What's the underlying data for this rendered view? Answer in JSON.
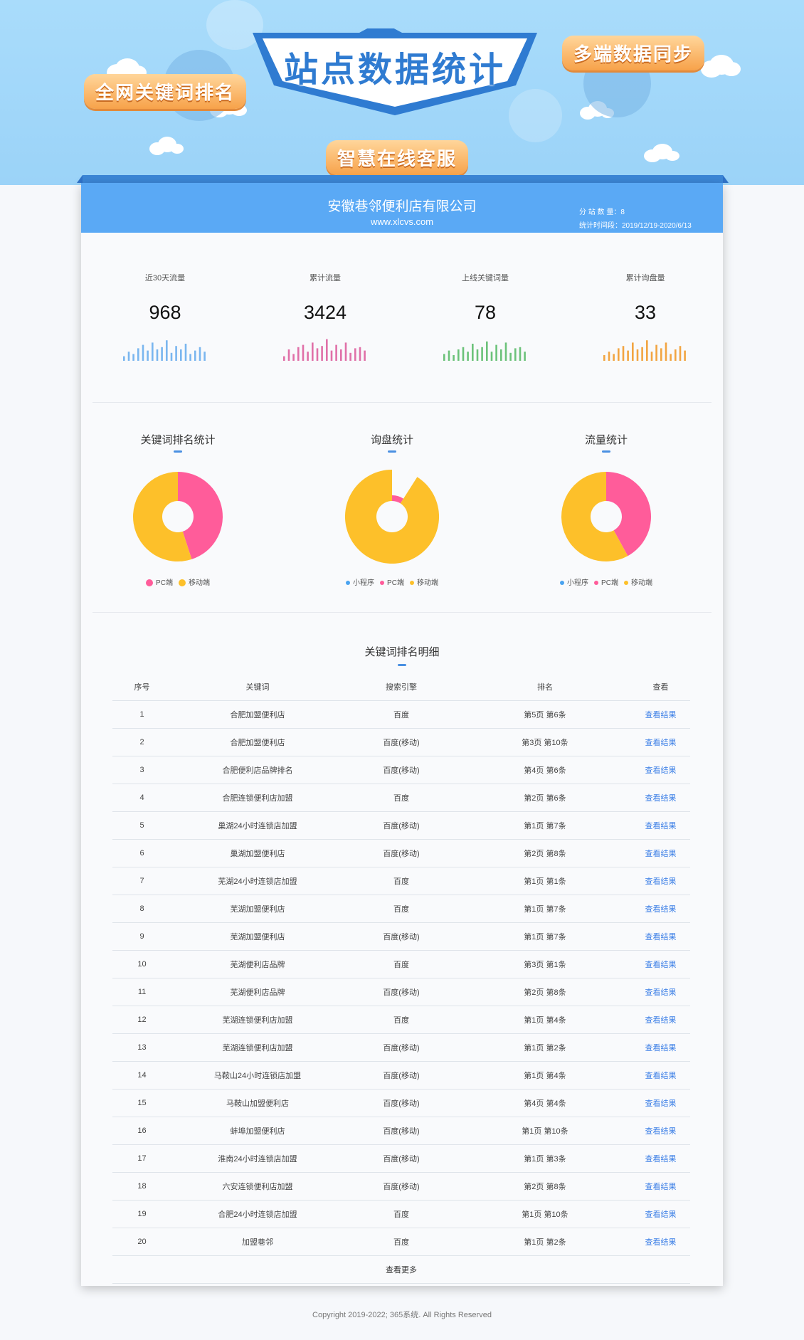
{
  "banner": {
    "title": "站点数据统计",
    "ribbon_left": "全网关键词排名",
    "ribbon_right": "多端数据同步",
    "ribbon_bottom": "智慧在线客服"
  },
  "header": {
    "company": "安徽巷邻便利店有限公司",
    "url": "www.xlcvs.com",
    "site_count": "分 站 数 量：8",
    "period": "统计时间段：2019/12/19-2020/6/13",
    "accent": "#5aa9f5"
  },
  "stats": [
    {
      "label": "近30天流量",
      "value": "968",
      "spark_color": "#7ab6ef",
      "bars": [
        0.2,
        0.4,
        0.3,
        0.55,
        0.7,
        0.45,
        0.8,
        0.5,
        0.6,
        0.9,
        0.35,
        0.65,
        0.5,
        0.75,
        0.3,
        0.45,
        0.6,
        0.4
      ]
    },
    {
      "label": "累计流量",
      "value": "3424",
      "spark_color": "#e070a8",
      "bars": [
        0.2,
        0.5,
        0.3,
        0.6,
        0.7,
        0.4,
        0.8,
        0.55,
        0.65,
        0.95,
        0.45,
        0.7,
        0.5,
        0.8,
        0.35,
        0.55,
        0.6,
        0.45
      ]
    },
    {
      "label": "上线关键词量",
      "value": "78",
      "spark_color": "#6cc27a",
      "bars": [
        0.3,
        0.45,
        0.25,
        0.5,
        0.6,
        0.4,
        0.75,
        0.5,
        0.6,
        0.85,
        0.4,
        0.7,
        0.5,
        0.8,
        0.35,
        0.55,
        0.6,
        0.4
      ]
    },
    {
      "label": "累计询盘量",
      "value": "33",
      "spark_color": "#f2a542",
      "bars": [
        0.25,
        0.4,
        0.3,
        0.55,
        0.65,
        0.45,
        0.8,
        0.5,
        0.6,
        0.9,
        0.4,
        0.7,
        0.55,
        0.8,
        0.3,
        0.5,
        0.65,
        0.45
      ]
    }
  ],
  "pies": [
    {
      "title": "关键词排名统计",
      "slices": [
        {
          "name": "PC端",
          "value": 45,
          "color": "#ff5c9a"
        },
        {
          "name": "移动端",
          "value": 55,
          "color": "#fdc02a"
        }
      ],
      "legend": [
        "PC端",
        "移动端"
      ],
      "legend_colors": [
        "#ff5c9a",
        "#fdc02a"
      ],
      "legend_dot": 10
    },
    {
      "title": "询盘统计",
      "slices": [
        {
          "name": "小程序",
          "value": 0,
          "color": "#4aa3f0"
        },
        {
          "name": "PC端",
          "value": 9,
          "color": "#ff5c9a"
        },
        {
          "name": "移动端",
          "value": 91,
          "color": "#fdc02a"
        }
      ],
      "legend": [
        "小程序",
        "PC端",
        "移动端"
      ],
      "legend_colors": [
        "#4aa3f0",
        "#ff5c9a",
        "#fdc02a"
      ],
      "legend_dot": 6
    },
    {
      "title": "流量统计",
      "slices": [
        {
          "name": "小程序",
          "value": 0,
          "color": "#4aa3f0"
        },
        {
          "name": "PC端",
          "value": 42,
          "color": "#ff5c9a"
        },
        {
          "name": "移动端",
          "value": 58,
          "color": "#fdc02a"
        }
      ],
      "legend": [
        "小程序",
        "PC端",
        "移动端"
      ],
      "legend_colors": [
        "#4aa3f0",
        "#ff5c9a",
        "#fdc02a"
      ],
      "legend_dot": 6
    }
  ],
  "table": {
    "title": "关键词排名明细",
    "columns": [
      "序号",
      "关键词",
      "搜索引擎",
      "排名",
      "查看"
    ],
    "link_text": "查看结果",
    "more": "查看更多",
    "rows": [
      [
        "1",
        "合肥加盟便利店",
        "百度",
        "第5页 第6条"
      ],
      [
        "2",
        "合肥加盟便利店",
        "百度(移动)",
        "第3页 第10条"
      ],
      [
        "3",
        "合肥便利店品牌排名",
        "百度(移动)",
        "第4页 第6条"
      ],
      [
        "4",
        "合肥连锁便利店加盟",
        "百度",
        "第2页 第6条"
      ],
      [
        "5",
        "巢湖24小时连锁店加盟",
        "百度(移动)",
        "第1页 第7条"
      ],
      [
        "6",
        "巢湖加盟便利店",
        "百度(移动)",
        "第2页 第8条"
      ],
      [
        "7",
        "芜湖24小时连锁店加盟",
        "百度",
        "第1页 第1条"
      ],
      [
        "8",
        "芜湖加盟便利店",
        "百度",
        "第1页 第7条"
      ],
      [
        "9",
        "芜湖加盟便利店",
        "百度(移动)",
        "第1页 第7条"
      ],
      [
        "10",
        "芜湖便利店品牌",
        "百度",
        "第3页 第1条"
      ],
      [
        "11",
        "芜湖便利店品牌",
        "百度(移动)",
        "第2页 第8条"
      ],
      [
        "12",
        "芜湖连锁便利店加盟",
        "百度",
        "第1页 第4条"
      ],
      [
        "13",
        "芜湖连锁便利店加盟",
        "百度(移动)",
        "第1页 第2条"
      ],
      [
        "14",
        "马鞍山24小时连锁店加盟",
        "百度(移动)",
        "第1页 第4条"
      ],
      [
        "15",
        "马鞍山加盟便利店",
        "百度(移动)",
        "第4页 第4条"
      ],
      [
        "16",
        "蚌埠加盟便利店",
        "百度(移动)",
        "第1页 第10条"
      ],
      [
        "17",
        "淮南24小时连锁店加盟",
        "百度(移动)",
        "第1页 第3条"
      ],
      [
        "18",
        "六安连锁便利店加盟",
        "百度(移动)",
        "第2页 第8条"
      ],
      [
        "19",
        "合肥24小时连锁店加盟",
        "百度",
        "第1页 第10条"
      ],
      [
        "20",
        "加盟巷邻",
        "百度",
        "第1页 第2条"
      ]
    ]
  },
  "footer": "Copyright 2019-2022; 365系统. All Rights Reserved"
}
